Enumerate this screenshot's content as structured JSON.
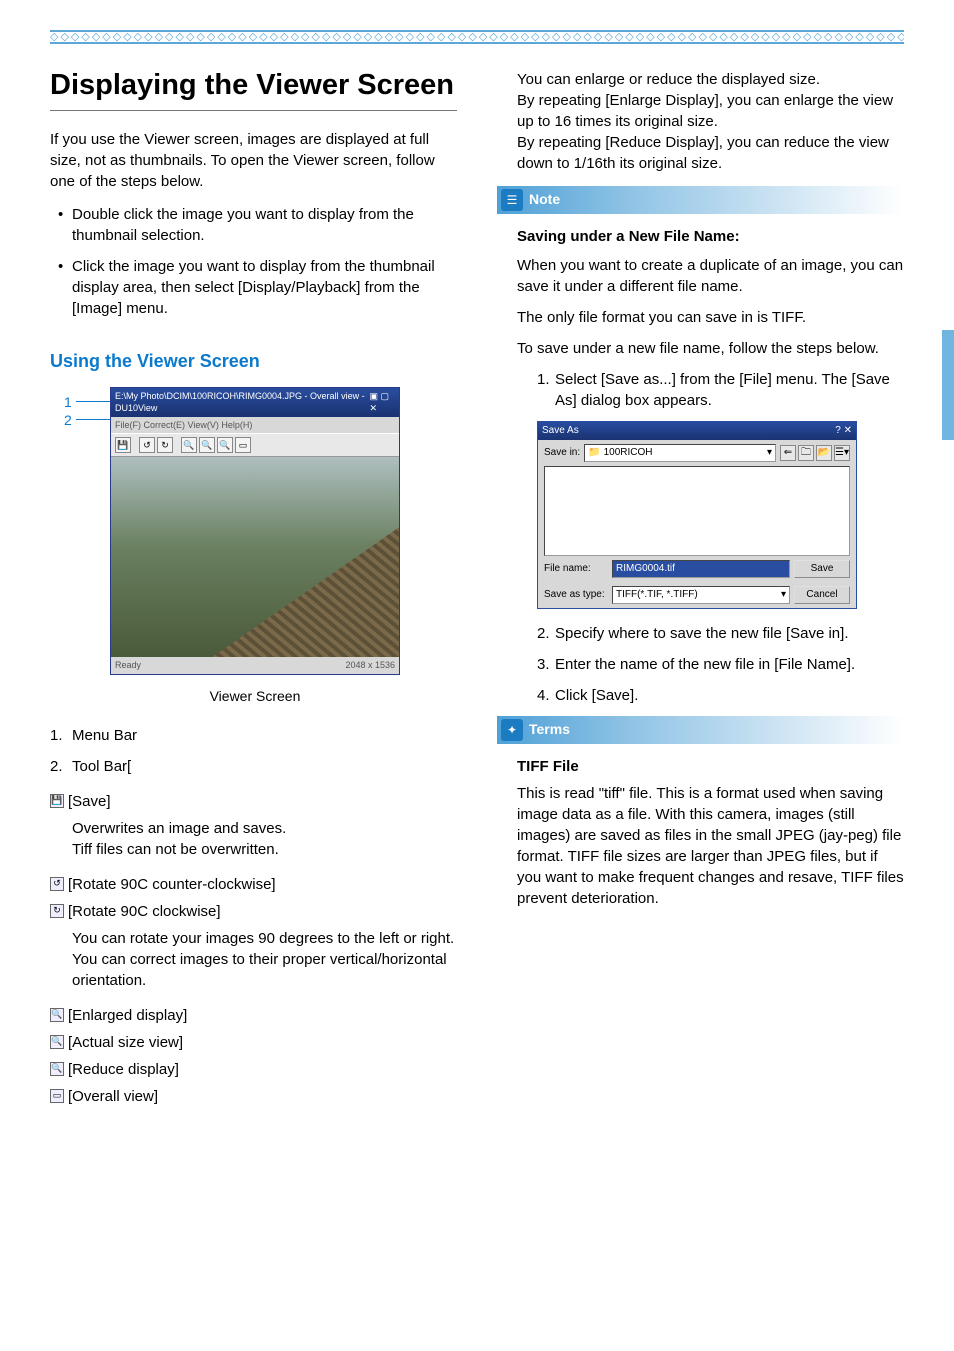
{
  "decor": "◇◇◇◇◇◇◇◇◇◇◇◇◇◇◇◇◇◇◇◇◇◇◇◇◇◇◇◇◇◇◇◇◇◇◇◇◇◇◇◇◇◇◇◇◇◇◇◇◇◇◇◇◇◇◇◇◇◇◇◇◇◇◇◇◇◇◇◇◇◇◇◇◇◇◇◇◇◇◇◇◇◇◇◇◇◇",
  "left": {
    "title": "Displaying the Viewer Screen",
    "intro": "If you use the Viewer screen, images are displayed at full size, not as thumbnails. To open the Viewer screen, follow one of the steps below.",
    "bullets": [
      "Double click the image you want to display from the thumbnail selection.",
      "Click the image you want to display from the thumbnail display area, then select [Display/Playback] from the [Image] menu."
    ],
    "section_heading": "Using the Viewer Screen",
    "callouts": {
      "one": "1",
      "two": "2"
    },
    "viewer": {
      "titlebar": "E:\\My Photo\\DCIM\\100RICOH\\RIMG0004.JPG  -  Overall view - DU10View",
      "menus": "File(F)  Correct(E)  View(V)  Help(H)",
      "status_left": "Ready",
      "status_right": "2048 x 1536"
    },
    "caption": "Viewer Screen",
    "numbered": [
      {
        "n": "1.",
        "t": "Menu Bar"
      },
      {
        "n": "2.",
        "t": "Tool Bar["
      }
    ],
    "tools": {
      "save": "[Save]",
      "save_desc": "Overwrites an image and saves.\nTiff files can not be overwritten.",
      "rot_ccw": "[Rotate 90C  counter-clockwise]",
      "rot_cw": "[Rotate 90C  clockwise]",
      "rot_desc": "You can rotate your images 90 degrees to the left or right.\nYou can correct images to their proper vertical/horizontal orientation.",
      "enlarge": "[Enlarged display]",
      "actual": "[Actual size view]",
      "reduce": "[Reduce display]",
      "overall": "[Overall view]"
    }
  },
  "right": {
    "top_para": "You can enlarge or reduce the displayed size.\nBy repeating [Enlarge Display], you can enlarge the view up to 16 times its original size.\nBy repeating [Reduce Display], you can reduce the view down to 1/16th its original size.",
    "note_label": "Note",
    "note_title": "Saving under a New File Name:",
    "note_p1": "When you want to create a duplicate of an image, you can save it under a different file name.",
    "note_p2": "The only file format you can save in is  TIFF.",
    "note_p3": "To save under a new file name, follow the steps below.",
    "step1": "Select [Save as...] from the [File] menu. The [Save As] dialog box appears.",
    "saveas": {
      "title": "Save As",
      "savein_label": "Save in:",
      "savein_value": "100RICOH",
      "filename_label": "File name:",
      "filename_value": "RIMG0004.tif",
      "type_label": "Save as type:",
      "type_value": "TIFF(*.TIF, *.TIFF)",
      "save_btn": "Save",
      "cancel_btn": "Cancel"
    },
    "step2": "Specify where to save the new file  [Save in].",
    "step3": "Enter the name of the new file in [File Name].",
    "step4": "Click [Save].",
    "terms_label": "Terms",
    "terms_title": "TIFF File",
    "terms_body": "This is read \"tiff\" file. This is a format used when saving image data as a file. With this camera, images (still images) are saved as files in the small JPEG (jay-peg) file format. TIFF file sizes are larger than JPEG files, but if you want to make frequent changes and resave, TIFF files prevent deterioration."
  }
}
